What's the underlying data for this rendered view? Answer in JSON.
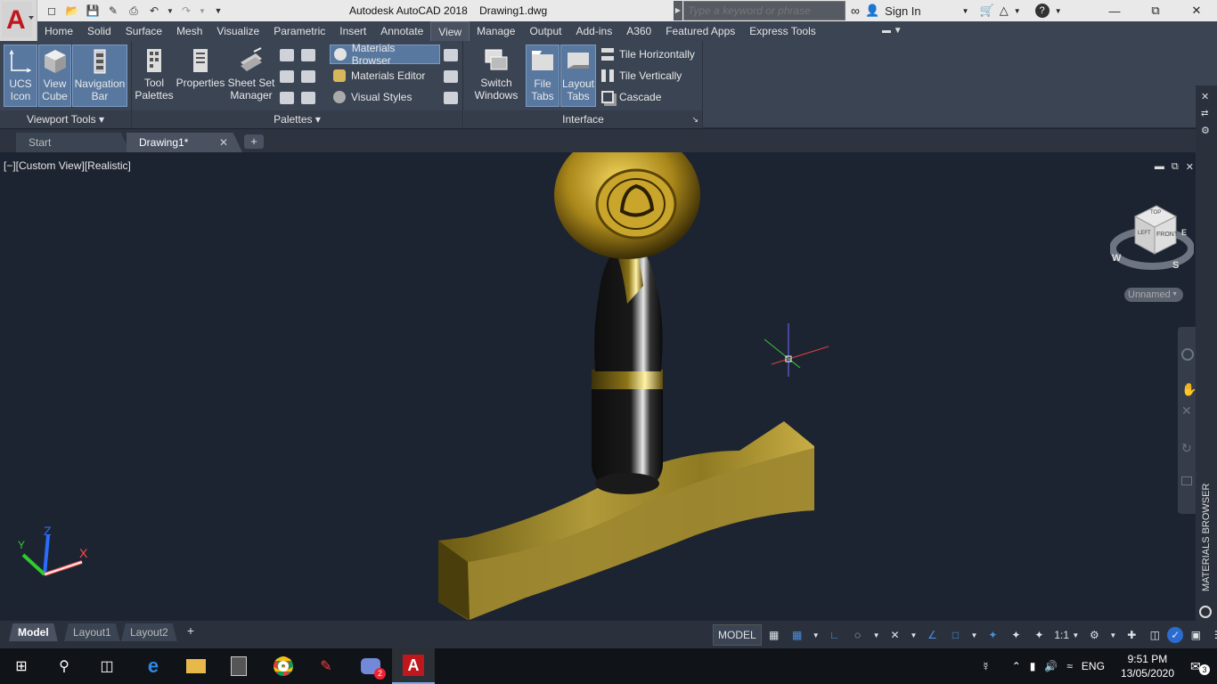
{
  "title_bar": {
    "app_title": "Autodesk AutoCAD 2018",
    "document": "Drawing1.dwg",
    "search_placeholder": "Type a keyword or phrase",
    "sign_in": "Sign In"
  },
  "menu_tabs": [
    "Home",
    "Solid",
    "Surface",
    "Mesh",
    "Visualize",
    "Parametric",
    "Insert",
    "Annotate",
    "View",
    "Manage",
    "Output",
    "Add-ins",
    "A360",
    "Featured Apps",
    "Express Tools"
  ],
  "active_tab": "View",
  "ribbon": {
    "viewport_tools": {
      "title": "Viewport Tools",
      "ucs_line1": "UCS",
      "ucs_line2": "Icon",
      "viewcube_line1": "View",
      "viewcube_line2": "Cube",
      "navbar_line1": "Navigation",
      "navbar_line2": "Bar"
    },
    "palettes": {
      "title": "Palettes",
      "tool_line1": "Tool",
      "tool_line2": "Palettes",
      "properties": "Properties",
      "sheet_line1": "Sheet Set",
      "sheet_line2": "Manager",
      "materials_browser": "Materials Browser",
      "materials_editor": "Materials Editor",
      "visual_styles": "Visual Styles"
    },
    "interface": {
      "title": "Interface",
      "switch_line1": "Switch",
      "switch_line2": "Windows",
      "file_line1": "File",
      "file_line2": "Tabs",
      "layout_line1": "Layout",
      "layout_line2": "Tabs",
      "tile_h": "Tile Horizontally",
      "tile_v": "Tile Vertically",
      "cascade": "Cascade"
    }
  },
  "file_tabs": {
    "start": "Start",
    "drawing": "Drawing1*"
  },
  "viewport": {
    "label": "[−][Custom View][Realistic]",
    "viewcube_top": "TOP",
    "viewcube_front": "FRONT",
    "viewcube_left": "LEFT",
    "compass_w": "W",
    "compass_s": "S",
    "compass_e": "E",
    "named_view": "Unnamed",
    "ucs_x": "X",
    "ucs_y": "Y",
    "ucs_z": "Z"
  },
  "side_palette": {
    "label": "MATERIALS BROWSER"
  },
  "layout_tabs": {
    "model": "Model",
    "layout1": "Layout1",
    "layout2": "Layout2"
  },
  "status_bar": {
    "model": "MODEL",
    "scale": "1:1"
  },
  "taskbar": {
    "language": "ENG",
    "time": "9:51 PM",
    "date": "13/05/2020",
    "notifications": "3",
    "discord_badge": "2"
  },
  "colors": {
    "accent": "#5878a0",
    "ribbon_bg": "#3b4453",
    "viewport_bg": "#1d2431",
    "autocad_red": "#c0171c"
  }
}
